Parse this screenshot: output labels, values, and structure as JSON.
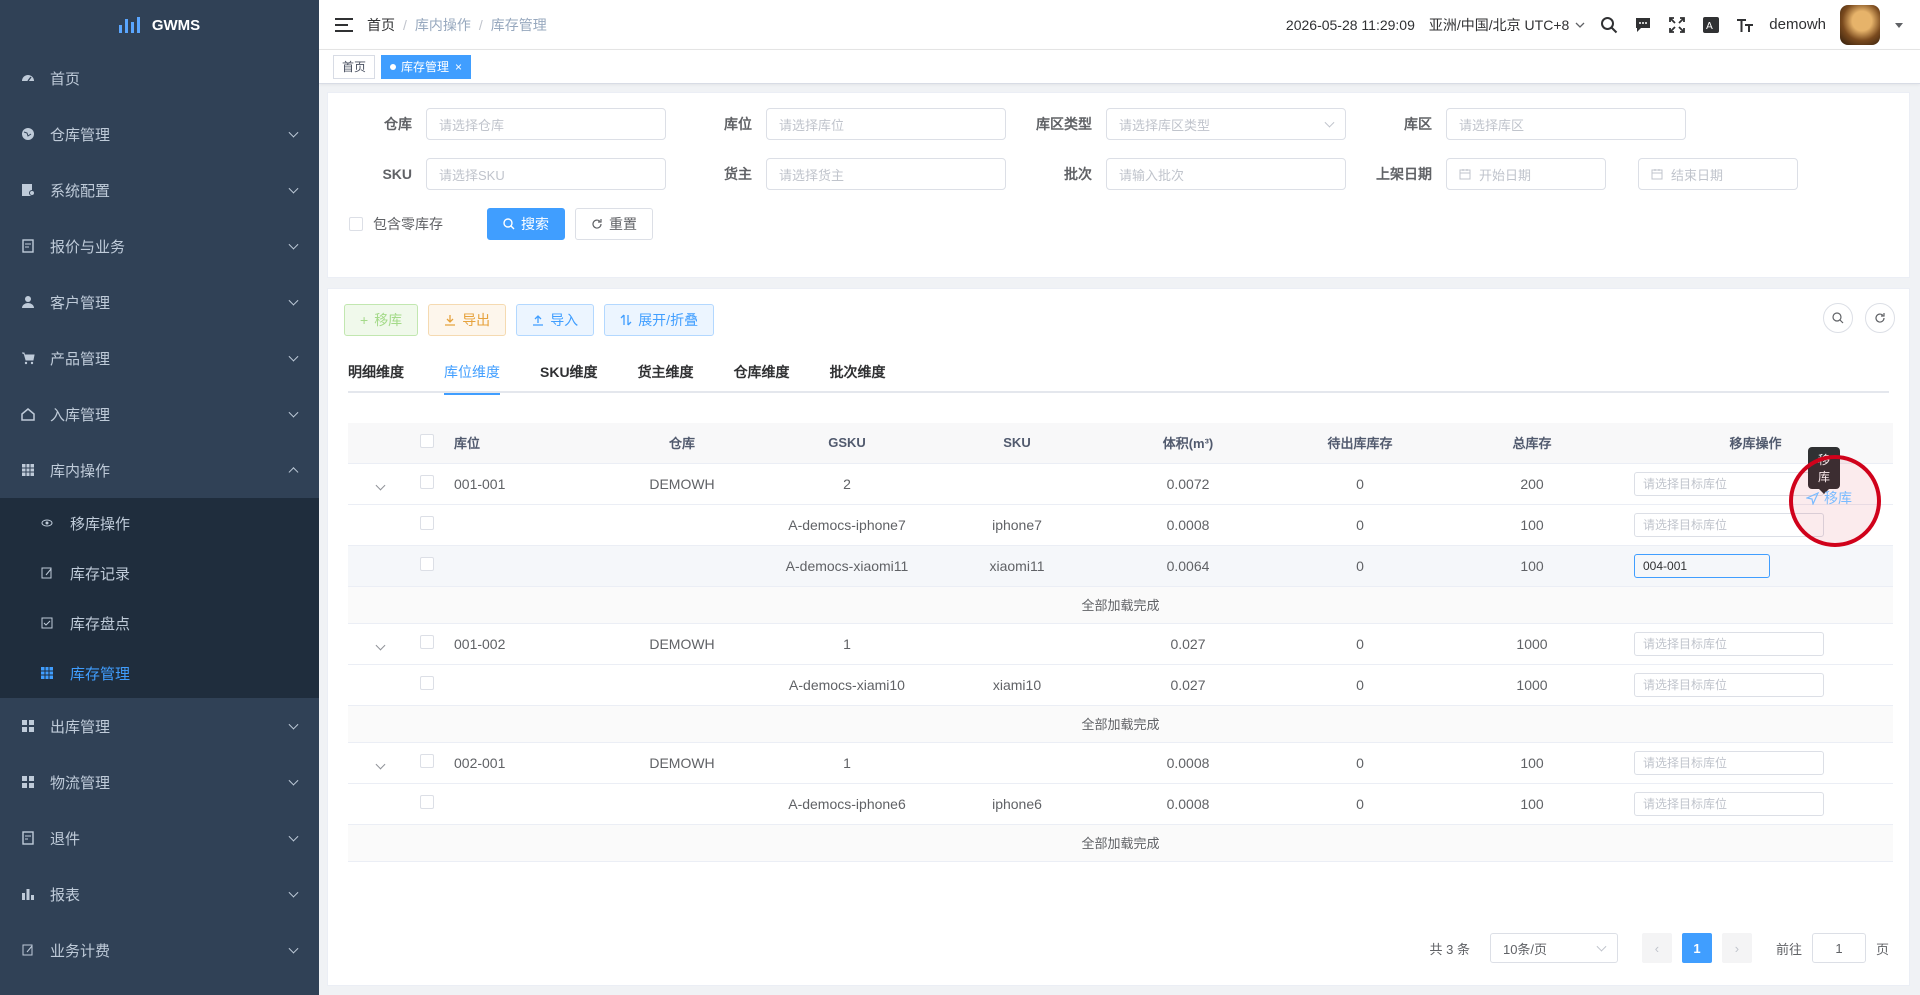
{
  "app": {
    "title": "GWMS"
  },
  "sidebar": {
    "items": [
      {
        "label": "首页",
        "icon": "dashboard-icon"
      },
      {
        "label": "仓库管理",
        "icon": "globe-icon"
      },
      {
        "label": "系统配置",
        "icon": "settings-doc-icon"
      },
      {
        "label": "报价与业务",
        "icon": "quote-doc-icon"
      },
      {
        "label": "客户管理",
        "icon": "user-icon"
      },
      {
        "label": "产品管理",
        "icon": "cart-icon"
      },
      {
        "label": "入库管理",
        "icon": "home-icon"
      },
      {
        "label": "库内操作",
        "icon": "table-icon"
      }
    ],
    "subitems": [
      {
        "label": "移库操作",
        "icon": "eye-icon"
      },
      {
        "label": "库存记录",
        "icon": "edit-icon"
      },
      {
        "label": "库存盘点",
        "icon": "checkbox-icon"
      },
      {
        "label": "库存管理",
        "icon": "grid-icon"
      }
    ],
    "items_after": [
      {
        "label": "出库管理",
        "icon": "apps-icon"
      },
      {
        "label": "物流管理",
        "icon": "apps-icon"
      },
      {
        "label": "退件",
        "icon": "return-doc-icon"
      },
      {
        "label": "报表",
        "icon": "chart-icon"
      },
      {
        "label": "业务计费",
        "icon": "edit-icon"
      }
    ]
  },
  "header": {
    "breadcrumb": [
      "首页",
      "库内操作",
      "库存管理"
    ],
    "datetime": "2026-05-28 11:29:09",
    "timezone": "亚洲/中国/北京 UTC+8",
    "username": "demowh"
  },
  "tags": {
    "home": "首页",
    "current": "库存管理"
  },
  "search": {
    "labels": {
      "warehouse": "仓库",
      "location": "库位",
      "zone_type": "库区类型",
      "zone": "库区",
      "sku": "SKU",
      "owner": "货主",
      "batch": "批次",
      "shelf_date": "上架日期"
    },
    "placeholders": {
      "warehouse": "请选择仓库",
      "location": "请选择库位",
      "zone_type": "请选择库区类型",
      "zone": "请选择库区",
      "sku": "请选择SKU",
      "owner": "请选择货主",
      "batch": "请输入批次",
      "start_date": "开始日期",
      "end_date": "结束日期"
    },
    "include_zero": "包含零库存",
    "search_btn": "搜索",
    "reset_btn": "重置"
  },
  "toolbar": {
    "move": "移库",
    "export": "导出",
    "import": "导入",
    "expand": "展开/折叠"
  },
  "tabs": [
    "明细维度",
    "库位维度",
    "SKU维度",
    "货主维度",
    "仓库维度",
    "批次维度"
  ],
  "table": {
    "headers": [
      "库位",
      "仓库",
      "GSKU",
      "SKU",
      "体积(m³)",
      "待出库库存",
      "总库存",
      "移库操作"
    ],
    "row_placeholder": "请选择目标库位",
    "loaded_text": "全部加载完成",
    "groups": [
      {
        "location": "001-001",
        "warehouse": "DEMOWH",
        "gsku": "2",
        "volume": "0.0072",
        "pending": "0",
        "total": "200",
        "children": [
          {
            "gsku": "A-democs-iphone7",
            "sku": "iphone7",
            "volume": "0.0008",
            "pending": "0",
            "total": "100"
          },
          {
            "gsku": "A-democs-xiaomi11",
            "sku": "xiaomi11",
            "volume": "0.0064",
            "pending": "0",
            "total": "100",
            "target": "004-001"
          }
        ]
      },
      {
        "location": "001-002",
        "warehouse": "DEMOWH",
        "gsku": "1",
        "volume": "0.027",
        "pending": "0",
        "total": "1000",
        "children": [
          {
            "gsku": "A-democs-xiami10",
            "sku": "xiami10",
            "volume": "0.027",
            "pending": "0",
            "total": "1000"
          }
        ]
      },
      {
        "location": "002-001",
        "warehouse": "DEMOWH",
        "gsku": "1",
        "volume": "0.0008",
        "pending": "0",
        "total": "100",
        "children": [
          {
            "gsku": "A-democs-iphone6",
            "sku": "iphone6",
            "volume": "0.0008",
            "pending": "0",
            "total": "100"
          }
        ]
      }
    ],
    "move_link": "移库",
    "move_tooltip": "移库"
  },
  "pager": {
    "total": "共 3 条",
    "page_size": "10条/页",
    "current": "1",
    "goto_label": "前往",
    "goto_value": "1",
    "page_suffix": "页"
  },
  "colors": {
    "sidebar_bg": "#304156",
    "primary": "#409eff",
    "highlight_ring": "#d0021b"
  }
}
